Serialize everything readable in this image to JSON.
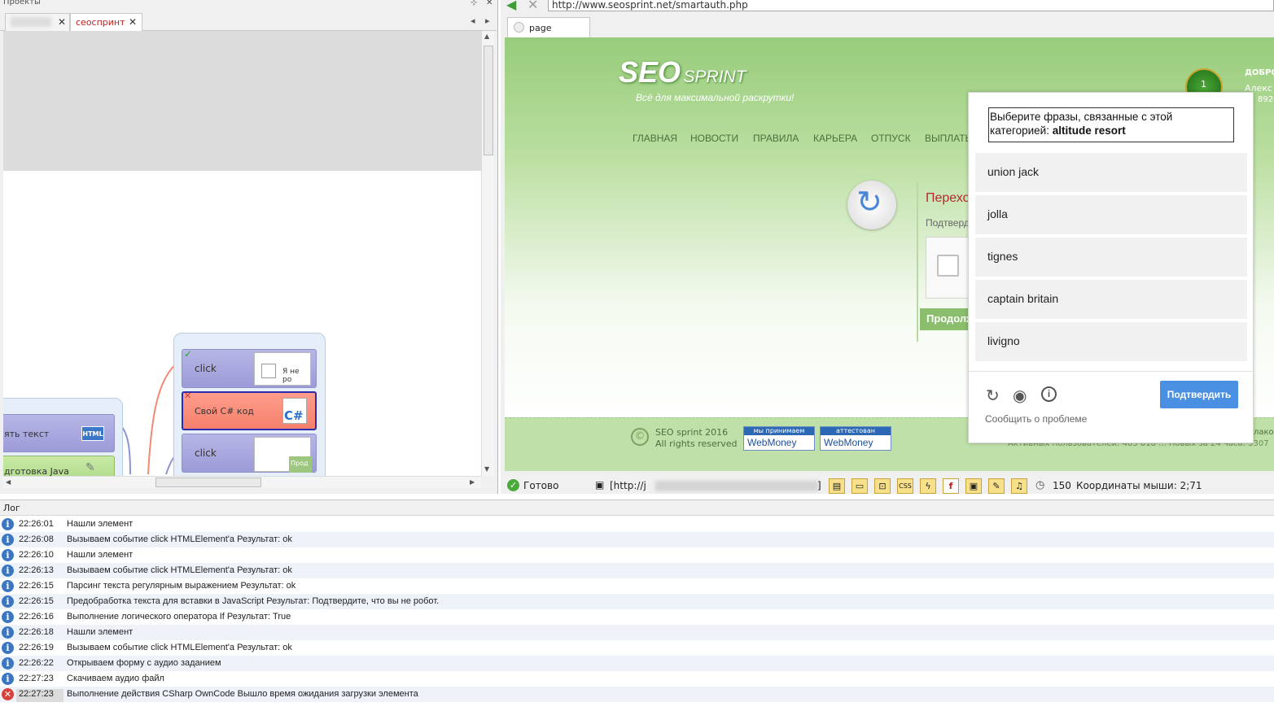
{
  "left_pane": {
    "title": "Проекты",
    "pin": "⊹",
    "close": "✕",
    "tabs": [
      {
        "label": "",
        "close": "✕"
      },
      {
        "label": "сеоспринт",
        "close": "✕"
      }
    ],
    "nav_left": "◂",
    "nav_right": "▸",
    "nodes": {
      "click1_label": "click",
      "click1_thumb": "Я не ро",
      "csharp_label": "Свой C# код",
      "csharp_icon": "C#",
      "click2_label": "click",
      "click2_thumb": "Прод",
      "settext_label": "ять текст",
      "settext_badge": "HTML",
      "prepjava_label": "дготовка Java"
    }
  },
  "browser": {
    "url": "http://www.seosprint.net/smartauth.php",
    "tab_label": "page",
    "site": {
      "logo_seo": "SEO",
      "logo_sprint": "SPRINT",
      "slogan": "Всё для максимальной раскрутки!",
      "nav": [
        "ГЛАВНАЯ",
        "НОВОСТИ",
        "ПРАВИЛА",
        "КАРЬЕРА",
        "ОТПУСК",
        "ВЫПЛАТЫ"
      ],
      "greeting": "ДОБРО",
      "user_name": "Алекс",
      "user_id": "8924",
      "badge_num": "1",
      "panel_title": "Перехо",
      "panel_sub": "Подтверд",
      "continue_btn": "Продолж",
      "copyright_line1": "SEO sprint 2016",
      "copyright_line2": "All rights reserved",
      "wm1_top": "мы принимаем",
      "wm1_bottom": "WebMoney",
      "wm2_top": "аттестован",
      "wm2_bottom": "WebMoney",
      "stats": "Активных пользователей: 405 018 ... Новых за 24 часа: 5307",
      "footer_edge": "лако"
    },
    "captcha": {
      "prompt_line1": "Выберите фразы, связанные с этой",
      "prompt_line2": "категорией:",
      "category": "altitude resort",
      "choices": [
        "union jack",
        "jolla",
        "tignes",
        "captain britain",
        "livigno"
      ],
      "confirm_label": "Подтвердить",
      "report_label": "Сообщить о проблеме"
    }
  },
  "status_bar": {
    "ready": "Готово",
    "url_prefix": "[http://j",
    "url_suffix": "]",
    "timer": "150",
    "coords_label": "Координаты мыши: 2;71",
    "tool_icons": [
      "image-icon",
      "window-icon",
      "frame-icon",
      "css-icon",
      "flash-lightning-icon",
      "flash-icon",
      "monitor-icon",
      "java-icon",
      "audio-icon"
    ]
  },
  "log": {
    "title": "Лог",
    "rows": [
      {
        "type": "info",
        "time": "22:26:01",
        "msg": " Нашли элемент"
      },
      {
        "type": "info",
        "time": "22:26:08",
        "msg": "Вызываем событие click HTMLElement'a  Результат: ok"
      },
      {
        "type": "info",
        "time": "22:26:10",
        "msg": " Нашли элемент"
      },
      {
        "type": "info",
        "time": "22:26:13",
        "msg": "Вызываем событие click HTMLElement'a  Результат: ok"
      },
      {
        "type": "info",
        "time": "22:26:15",
        "msg": "Парсинг текста регулярным выражением  Результат: ok"
      },
      {
        "type": "info",
        "time": "22:26:15",
        "msg": "Предобработка текста для вставки в JavaScript  Результат: Подтвердите, что вы не робот."
      },
      {
        "type": "info",
        "time": "22:26:16",
        "msg": "Выполнение логического оператора If  Результат: True"
      },
      {
        "type": "info",
        "time": "22:26:18",
        "msg": " Нашли элемент"
      },
      {
        "type": "info",
        "time": "22:26:19",
        "msg": "Вызываем событие click HTMLElement'a  Результат: ok"
      },
      {
        "type": "info",
        "time": "22:26:22",
        "msg": " Открываем форму с аудио заданием"
      },
      {
        "type": "info",
        "time": "22:27:23",
        "msg": " Скачиваем аудио файл"
      },
      {
        "type": "error",
        "time": "22:27:23",
        "msg": "Выполнение действия CSharp OwnCode Вышло время ожидания загрузки элемента"
      }
    ]
  },
  "colors": {
    "site_green": "#98cc7c",
    "captcha_button": "#4a90e2",
    "log_info_icon": "#3b76c2",
    "log_error_icon": "#d8423d",
    "node_red": "#f5806c",
    "node_purple": "#9d9bd8"
  }
}
